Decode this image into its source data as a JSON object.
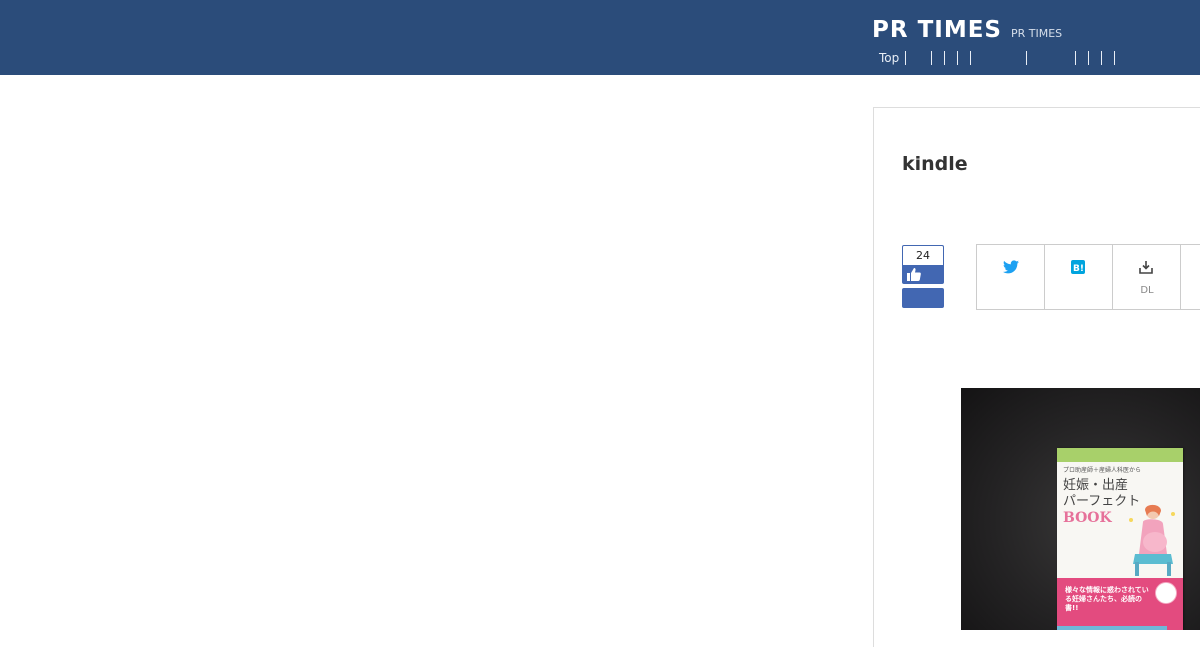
{
  "header": {
    "logo": "PR TIMES",
    "site_name": "PR TIMES",
    "nav": {
      "top_label": "Top"
    }
  },
  "article": {
    "title": "kindle",
    "likes": {
      "count": "24"
    },
    "social": {
      "twitter_icon": "twitter-icon",
      "hatena_icon": "hatena-bookmark-icon",
      "download_icon": "download-icon",
      "download_label": "DL"
    },
    "image": {
      "book": {
        "subtitle": "プロ助産師＋産婦人科医から",
        "title": "妊娠・出産\nパーフェクト",
        "title_en": "BOOK",
        "band_text": "様々な情報に惑わされている妊婦さんたち、必読の書!!"
      }
    }
  },
  "colors": {
    "header_bg": "#2b4c7a",
    "facebook_blue": "#4267b2",
    "twitter_blue": "#1da1f2",
    "hatena_blue": "#00a4de",
    "book_pink": "#e34b7f",
    "book_green": "#a8d06a"
  }
}
